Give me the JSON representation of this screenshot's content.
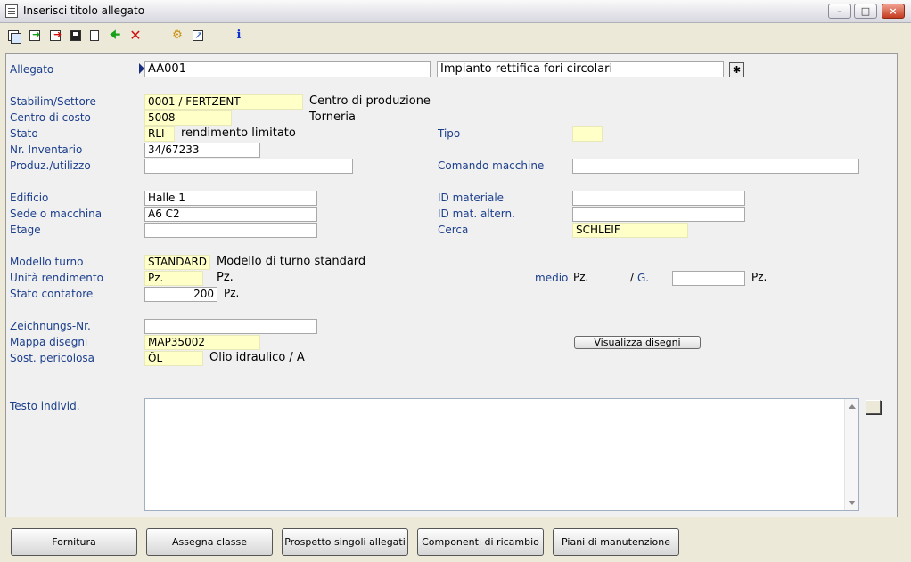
{
  "window": {
    "title": "Inserisci titolo allegato"
  },
  "allegato": {
    "label": "Allegato",
    "code": "AA001",
    "description": "Impianto rettifica fori circolari"
  },
  "left": {
    "stabilim_label": "Stabilim/Settore",
    "stabilim_code": "0001",
    "stabilim_sector": "/ FERTZENT",
    "stabilim_desc": "Centro di produzione",
    "centro_label": "Centro di costo",
    "centro_code": "5008",
    "centro_desc": "Torneria",
    "stato_label": "Stato",
    "stato_code": "RLI",
    "stato_desc": "rendimento limitato",
    "inventario_label": "Nr. Inventario",
    "inventario_value": "34/67233",
    "produz_label": "Produz./utilizzo",
    "produz_value": "",
    "edificio_label": "Edificio",
    "edificio_value": "Halle 1",
    "sede_label": "Sede o macchina",
    "sede_value": "A6 C2",
    "etage_label": "Etage",
    "etage_value": "",
    "modello_label": "Modello turno",
    "modello_code": "STANDARD",
    "modello_desc": "Modello di turno standard",
    "unita_label": "Unità rendimento",
    "unita_code": "Pz.",
    "unita_desc": "Pz.",
    "contatore_label": "Stato contatore",
    "contatore_value": "200",
    "contatore_unit": "Pz.",
    "zeich_label": "Zeichnungs-Nr.",
    "zeich_value": "",
    "mappa_label": "Mappa disegni",
    "mappa_value": "MAP35002",
    "sost_label": "Sost. pericolosa",
    "sost_code": "ÖL",
    "sost_desc": "Olio idraulico / A",
    "testo_label": "Testo individ.",
    "testo_value": ""
  },
  "right": {
    "tipo_label": "Tipo",
    "tipo_value": "",
    "comando_label": "Comando macchine",
    "comando_value": "",
    "idmat_label": "ID materiale",
    "idmat_value": "",
    "idmatalt_label": "ID mat. altern.",
    "idmatalt_value": "",
    "cerca_label": "Cerca",
    "cerca_value": "SCHLEIF",
    "medio_label": "medio",
    "medio_unit1": "Pz.",
    "medio_sep": "/",
    "medio_g": "G.",
    "medio_value": "",
    "medio_unit2": "Pz.",
    "visualizza_label": "Visualizza disegni"
  },
  "bottom_buttons": [
    "Fornitura",
    "Assegna classe",
    "Prospetto singoli allegati",
    "Componenti di ricambio",
    "Piani di manutenzione"
  ],
  "icons": [
    "copy-icon",
    "export-icon",
    "import-icon",
    "save-icon",
    "new-document-icon",
    "back-arrow-icon",
    "delete-icon",
    "settings-icon",
    "report-icon",
    "info-icon"
  ]
}
